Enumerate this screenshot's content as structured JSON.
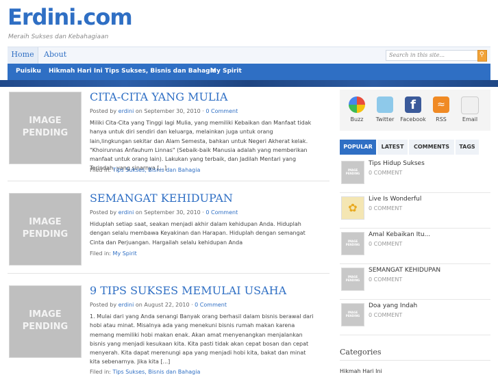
{
  "site": {
    "title": "Erdini.com",
    "tagline": "Meraih Sukses dan Kebahagiaan"
  },
  "topnav": {
    "items": [
      "Home",
      "About"
    ],
    "search_placeholder": "Search in this site...",
    "search_icon": "search-icon"
  },
  "catnav": {
    "items": [
      "Puisiku",
      "Hikmah Hari Ini",
      "Tips Sukses, Bisnis dan Bahagia",
      "My Spirit"
    ]
  },
  "posts": [
    {
      "thumb": "IMAGE PENDING",
      "title": "CITA-CITA YANG MULIA",
      "posted_by": "Posted by",
      "author": "erdini",
      "on": "on September 30, 2010 ·",
      "comments": "0 Comment",
      "excerpt": "Miliki Cita-Cita yang Tinggi lagi Mulia, yang memiliki Kebaikan dan Manfaat tidak hanya untuk diri sendiri dan keluarga, melainkan juga untuk orang lain,lingkungan sekitar dan Alam Semesta, bahkan untuk Negeri Akherat kelak. \"Khoirunnas Anfauhum Linnas\" (Sebaik-baik Manusia adalah yang memberikan manfaat untuk orang lain). Lakukan yang terbaik, dan Jadilah Mentari yang Terindah, yang sinarnya [...]",
      "filed_label": "Filed in:",
      "filed": "Tips Sukses, Bisnis dan Bahagia"
    },
    {
      "thumb": "IMAGE PENDING",
      "title": "SEMANGAT KEHIDUPAN",
      "posted_by": "Posted by",
      "author": "erdini",
      "on": "on September 30, 2010 ·",
      "comments": "0 Comment",
      "excerpt": "Hiduplah setiap saat, seakan menjadi akhir dalam kehidupan Anda. Hiduplah dengan selalu membawa Keyakinan dan Harapan. Hiduplah dengan semangat Cinta dan Perjuangan. Hargailah selalu kehidupan Anda",
      "filed_label": "Filed in:",
      "filed": "My Spirit"
    },
    {
      "thumb": "IMAGE PENDING",
      "title": "9 TIPS SUKSES MEMULAI USAHA",
      "posted_by": "Posted by",
      "author": "erdini",
      "on": "on August 22, 2010 ·",
      "comments": "0 Comment",
      "excerpt": "1.   Mulai dari yang Anda senangi Banyak orang berhasil dalam bisnis berawal dari hobi atau minat. Misalnya ada yang menekuni bisnis rumah makan karena memang memiliki hobi makan enak. Akan amat menyenangkan menjalankan bisnis yang menjadi kesukaan kita. Kita pasti tidak akan cepat bosan dan cepat menyerah. Kita dapat merenungi apa yang menjadi hobi kita, bakat dan minat kita sebenarnya. Jika kita [...]",
      "filed_label": "Filed in:",
      "filed": "Tips Sukses, Bisnis dan Bahagia"
    }
  ],
  "social": [
    {
      "label": "Buzz",
      "icon": "buzz-icon",
      "color": "#e8e8e8"
    },
    {
      "label": "Twitter",
      "icon": "twitter-icon",
      "color": "#8ec9ea"
    },
    {
      "label": "Facebook",
      "icon": "facebook-icon",
      "color": "#3b5a9a"
    },
    {
      "label": "RSS",
      "icon": "rss-icon",
      "color": "#f08a24"
    },
    {
      "label": "Email",
      "icon": "email-icon",
      "color": "#f0f0f0"
    }
  ],
  "tabs": [
    "POPULAR",
    "LATEST",
    "COMMENTS",
    "TAGS"
  ],
  "popular": [
    {
      "title": "Tips Hidup Sukses",
      "comments": "0 COMMENT"
    },
    {
      "title": "Live Is Wonderful",
      "comments": "0 COMMENT"
    },
    {
      "title": "Amal Kebaikan Itu...",
      "comments": "0 COMMENT"
    },
    {
      "title": "SEMANGAT KEHIDUPAN",
      "comments": "0 COMMENT"
    },
    {
      "title": "Doa yang Indah",
      "comments": "0 COMMENT"
    }
  ],
  "categories": {
    "heading": "Categories",
    "first": "Hikmah Hari Ini"
  },
  "colors": {
    "brand": "#2f6fc4",
    "accent": "#f2a33a"
  }
}
